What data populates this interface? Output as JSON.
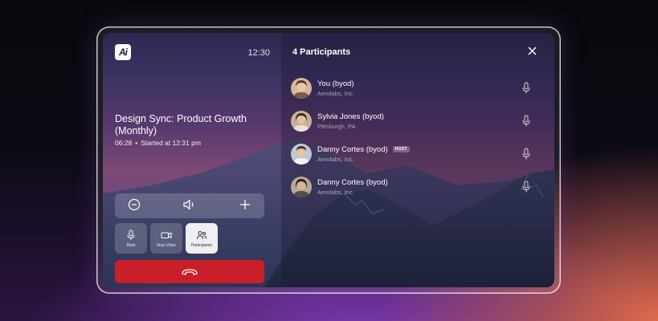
{
  "app": {
    "logo_text": "Ai",
    "time": "12:30"
  },
  "meeting": {
    "title": "Design Sync: Product Growth (Monthly)",
    "duration": "06:28",
    "started": "Started at 12:31 pm"
  },
  "controls": {
    "volume": {
      "decrease_icon": "minus-circle-icon",
      "speaker_icon": "speaker-icon",
      "increase_icon": "plus-icon"
    },
    "buttons": [
      {
        "label": "Mute",
        "icon": "microphone-icon"
      },
      {
        "label": "Stop Video",
        "icon": "video-camera-icon"
      },
      {
        "label": "Participants",
        "icon": "participants-icon"
      }
    ],
    "hangup_icon": "phone-hangup-icon"
  },
  "participants": {
    "title": "4 Participants",
    "list": [
      {
        "name": "You (byod)",
        "org": "Aerolabs, Inc."
      },
      {
        "name": "Sylvia Jones (byod)",
        "org": "Pittsburgh, PA"
      },
      {
        "name": "Danny Cortes (byod)",
        "org": "Aerolabs, Inc.",
        "badge": "HOST"
      },
      {
        "name": "Danny Cortes (byod)",
        "org": "Aerolabs, Inc."
      }
    ]
  },
  "colors": {
    "hangup": "#c81f2a",
    "accent_glow": "#8c3fc2"
  }
}
